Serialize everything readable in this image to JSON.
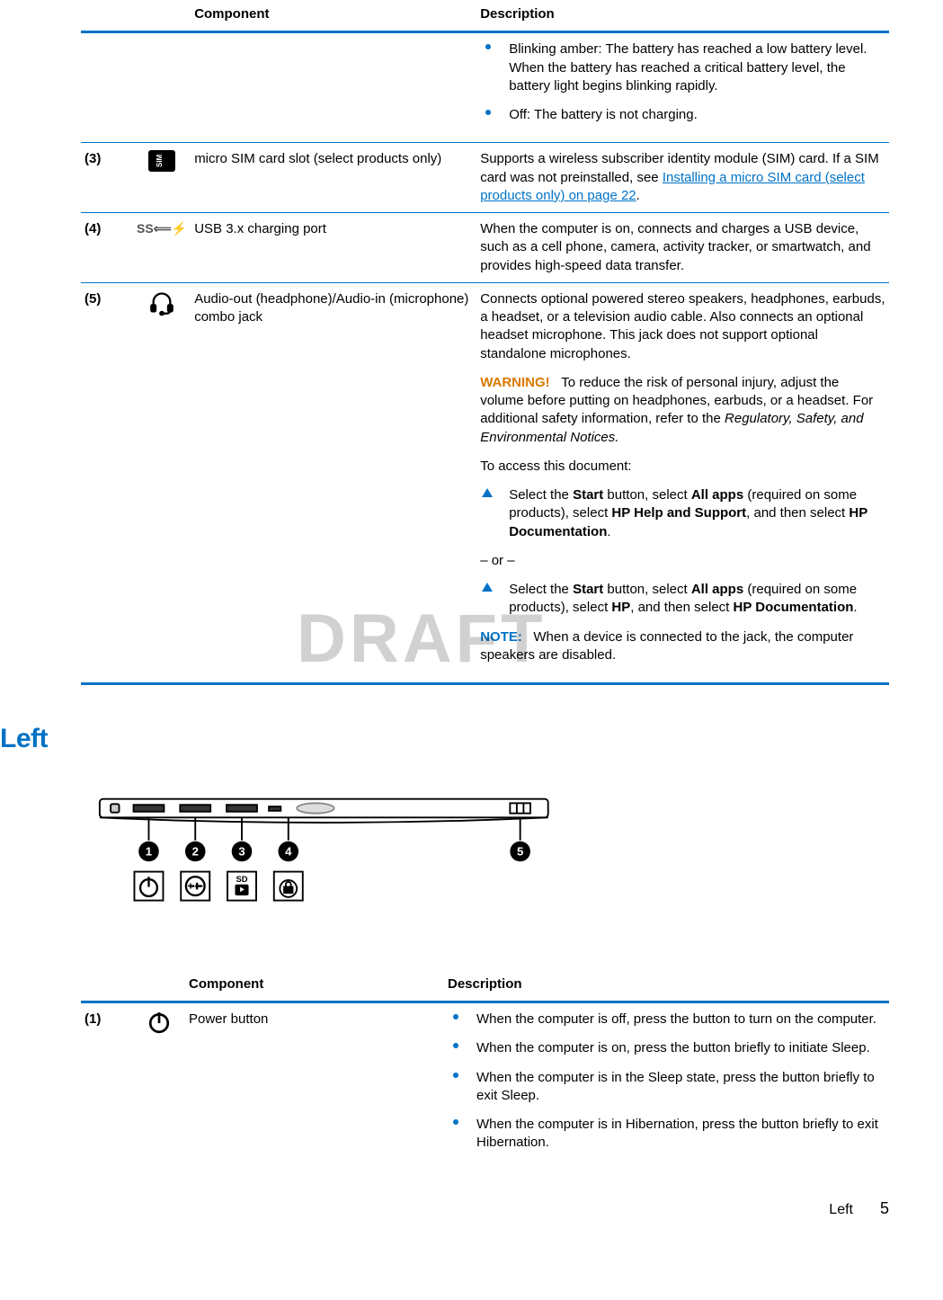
{
  "watermark": "DRAFT",
  "table1": {
    "header": {
      "component": "Component",
      "description": "Description"
    },
    "row_pre": {
      "bullets": [
        "Blinking amber: The battery has reached a low battery level. When the battery has reached a critical battery level, the battery light begins blinking rapidly.",
        "Off: The battery is not charging."
      ]
    },
    "row3": {
      "num": "(3)",
      "component": "micro SIM card slot (select products only)",
      "desc_a": "Supports a wireless subscriber identity module (SIM) card. If a SIM card was not preinstalled, see ",
      "desc_link": "Installing a micro SIM card (select products only) on page 22",
      "desc_b": "."
    },
    "row4": {
      "num": "(4)",
      "icon_text": "SS⟸⚡",
      "component": "USB 3.x charging port",
      "desc": "When the computer is on, connects and charges a USB device, such as a cell phone, camera, activity tracker, or smartwatch, and provides high-speed data transfer."
    },
    "row5": {
      "num": "(5)",
      "component": "Audio-out (headphone)/Audio-in (microphone) combo jack",
      "desc1": "Connects optional powered stereo speakers, headphones, earbuds, a headset, or a television audio cable. Also connects an optional headset microphone. This jack does not support optional standalone microphones.",
      "warn_label": "WARNING!",
      "warn_text": "To reduce the risk of personal injury, adjust the volume before putting on headphones, earbuds, or a headset. For additional safety information, refer to the ",
      "warn_italic": "Regulatory, Safety, and Environmental Notices.",
      "access": "To access this document:",
      "step1_a": "Select the ",
      "step1_b": "Start",
      "step1_c": " button, select ",
      "step1_d": "All apps",
      "step1_e": " (required on some products), select ",
      "step1_f": "HP Help and Support",
      "step1_g": ", and then select ",
      "step1_h": "HP Documentation",
      "step1_i": ".",
      "ordash": "– or –",
      "step2_a": "Select the ",
      "step2_b": "Start",
      "step2_c": " button, select ",
      "step2_d": "All apps",
      "step2_e": " (required on some products), select ",
      "step2_f": "HP",
      "step2_g": ", and then select ",
      "step2_h": "HP Documentation",
      "step2_i": ".",
      "note_label": "NOTE:",
      "note_text": "When a device is connected to the jack, the computer speakers are disabled."
    }
  },
  "section_heading": "Left",
  "figure": {
    "callouts": [
      "1",
      "2",
      "3",
      "4",
      "5"
    ],
    "port_glyphs": [
      "power",
      "volume",
      "sd",
      "lock",
      ""
    ]
  },
  "table2": {
    "header": {
      "component": "Component",
      "description": "Description"
    },
    "row1": {
      "num": "(1)",
      "component": "Power button",
      "bullets": [
        "When the computer is off, press the button to turn on the computer.",
        "When the computer is on, press the button briefly to initiate Sleep.",
        "When the computer is in the Sleep state, press the button briefly to exit Sleep.",
        "When the computer is in Hibernation, press the button briefly to exit Hibernation."
      ]
    }
  },
  "footer": {
    "section": "Left",
    "page": "5"
  }
}
